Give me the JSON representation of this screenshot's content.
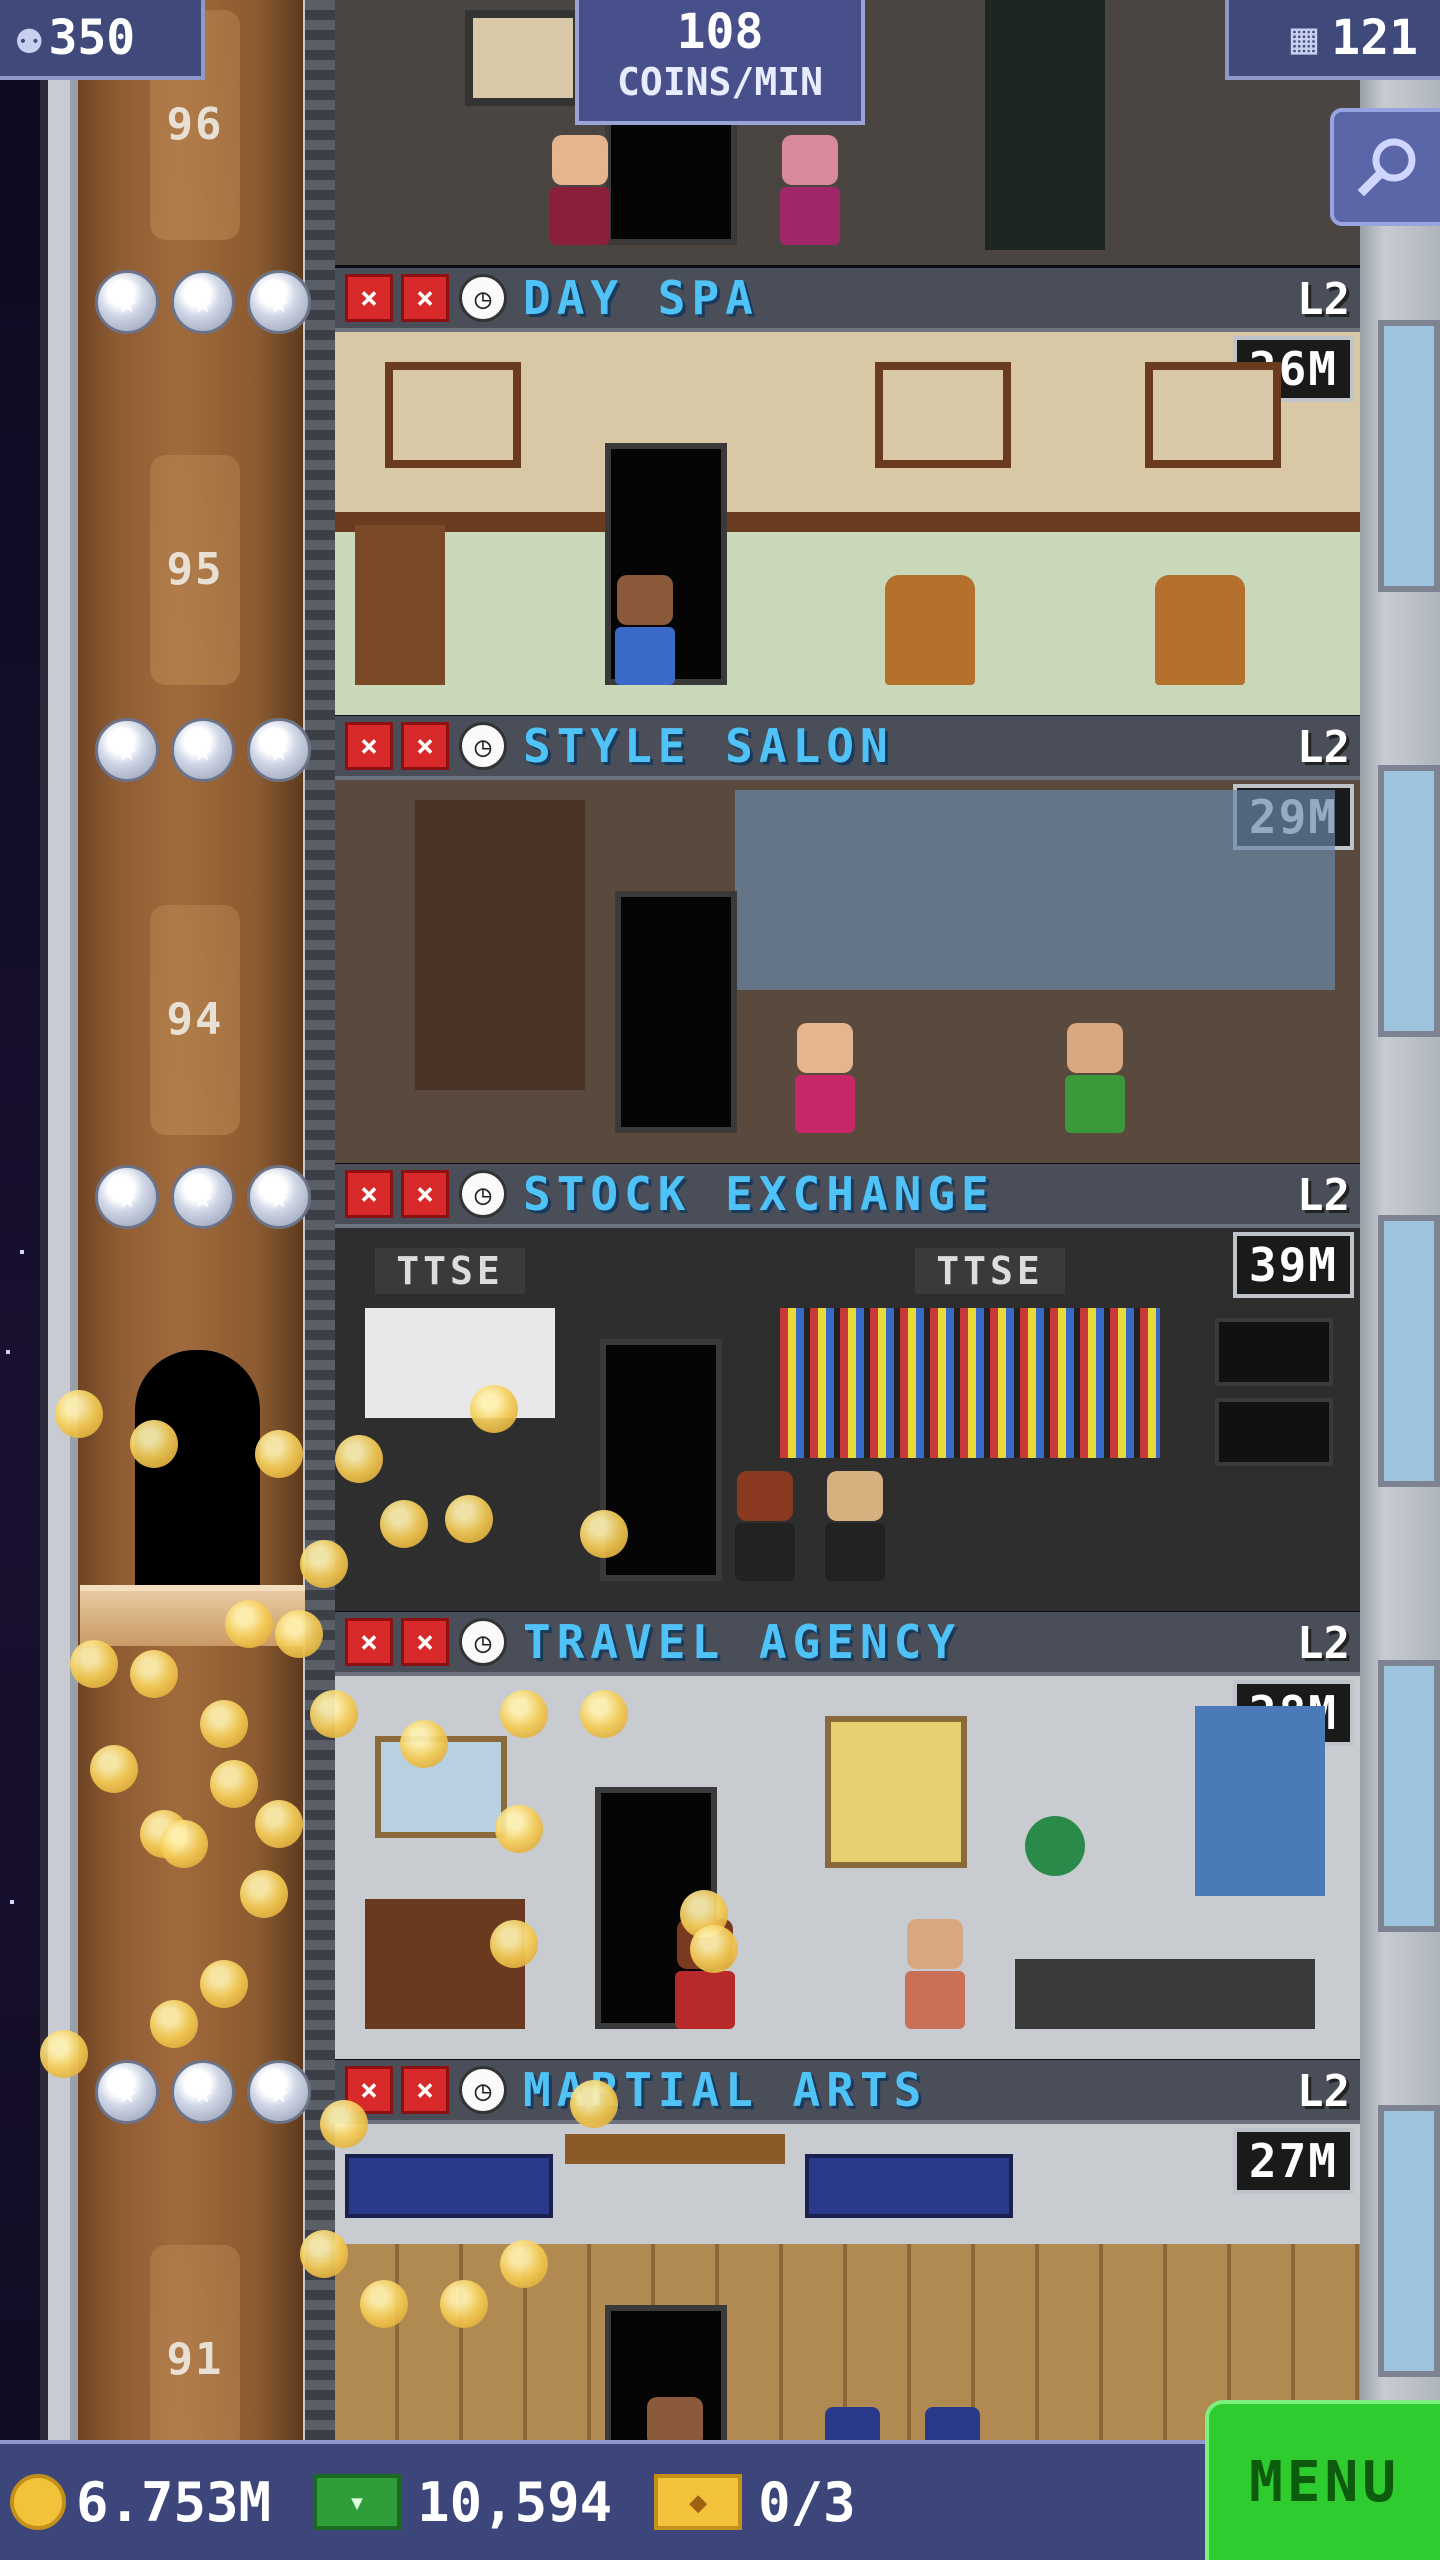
{
  "hud": {
    "population": "350",
    "coins_per_min_value": "108",
    "coins_per_min_label": "COINS/MIN",
    "floor_count": "121"
  },
  "shaft": {
    "floor_numbers": [
      "96",
      "95",
      "94",
      "91"
    ]
  },
  "floors": [
    {
      "name": "DAY SPA",
      "level": "L2",
      "money": "26M"
    },
    {
      "name": "STYLE SALON",
      "level": "L2",
      "money": "29M"
    },
    {
      "name": "STOCK EXCHANGE",
      "level": "L2",
      "money": "39M",
      "signs": [
        "TTSE",
        "TTSE"
      ]
    },
    {
      "name": "TRAVEL AGENCY",
      "level": "L2",
      "money": "28M"
    },
    {
      "name": "MARTIAL ARTS",
      "level": "L2",
      "money": "27M"
    }
  ],
  "bottom_bar": {
    "coins": "6.753M",
    "bux": "10,594",
    "tickets": "0/3",
    "menu_label": "MENU"
  },
  "colors": {
    "floor_name": "#4fc3f7",
    "menu_button": "#2ecc2e",
    "hud_background": "#3f4a7a",
    "shaft_wood": "#8f5c33"
  }
}
